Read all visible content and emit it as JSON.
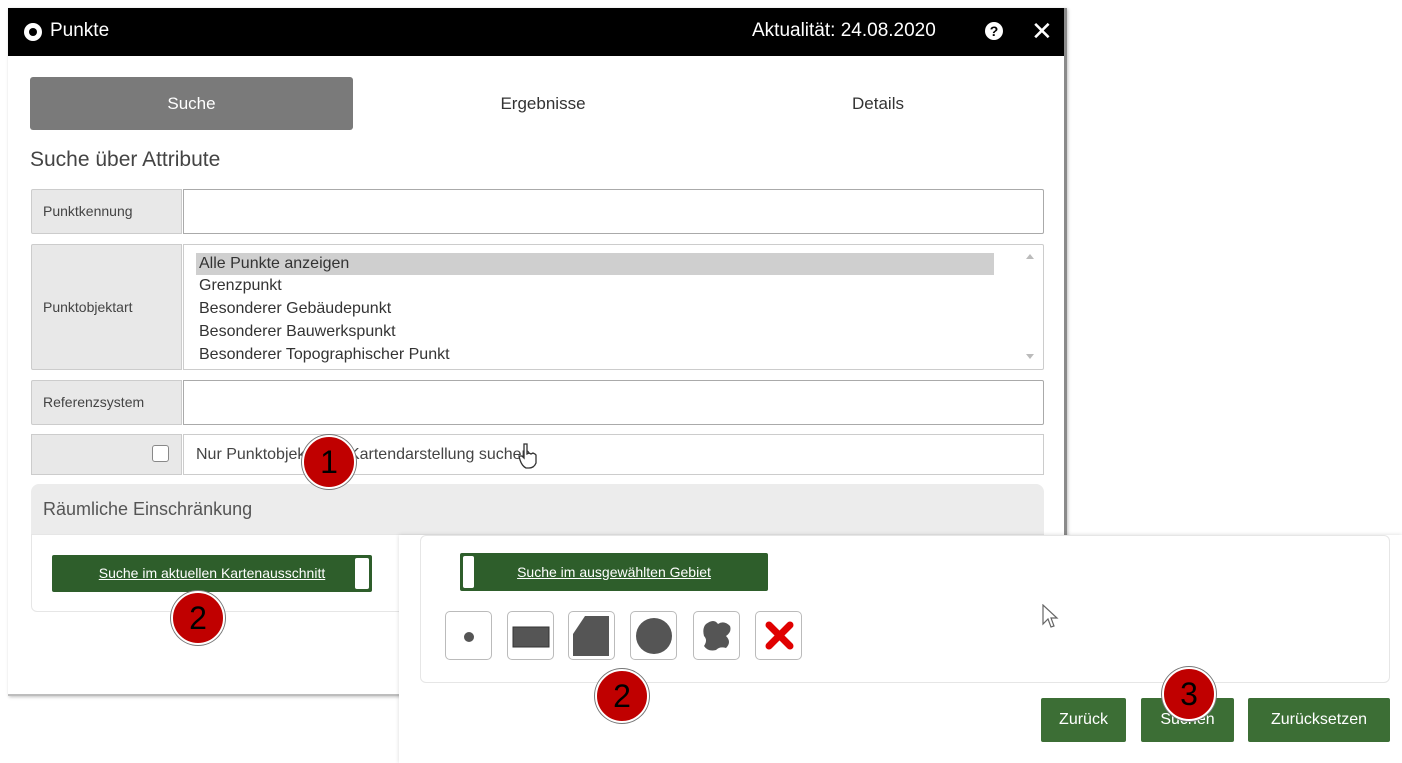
{
  "window": {
    "title": "Punkte",
    "date_label": "Aktualität: 24.08.2020",
    "help_glyph": "?",
    "close_glyph": "✕"
  },
  "tabs": [
    {
      "label": "Suche",
      "active": true
    },
    {
      "label": "Ergebnisse",
      "active": false
    },
    {
      "label": "Details",
      "active": false
    }
  ],
  "search": {
    "section_title": "Suche über Attribute",
    "punktkennung": {
      "label": "Punktkennung",
      "value": ""
    },
    "punktobjektart": {
      "label": "Punktobjektart",
      "options": [
        "Alle Punkte anzeigen",
        "Grenzpunkt",
        "Besonderer Gebäudepunkt",
        "Besonderer Bauwerkspunkt",
        "Besonderer Topographischer Punkt"
      ],
      "selected": "Alle Punkte anzeigen"
    },
    "referenzsystem": {
      "label": "Referenzsystem",
      "value": ""
    },
    "checkbox": {
      "label": "Nur Punktobjekte mit Kartendarstellung suchen",
      "checked": false
    }
  },
  "spatial": {
    "header": "Räumliche Einschränkung",
    "current_view_button": "Suche im aktuellen Kartenausschnitt",
    "selected_area_button": "Suche im ausgewählten Gebiet",
    "shape_tools": [
      "point-icon",
      "rectangle-icon",
      "polygon-icon",
      "circle-icon",
      "freehand-icon",
      "delete-icon"
    ]
  },
  "actions": {
    "back": "Zurück",
    "search": "Suchen",
    "reset": "Zurücksetzen"
  },
  "annotations": [
    "1",
    "2",
    "2",
    "3"
  ],
  "colors": {
    "titlebar": "#000000",
    "active_tab": "#7a7a7a",
    "green_button": "#2e5e2b",
    "action_button": "#3c6e35",
    "badge": "#c00000",
    "delete": "#e00000"
  }
}
